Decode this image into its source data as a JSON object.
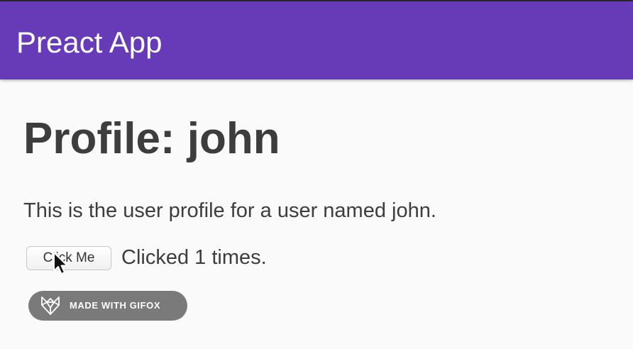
{
  "header": {
    "title": "Preact App",
    "background_color": "#673ab7"
  },
  "profile": {
    "heading": "Profile: john",
    "description": "This is the user profile for a user named john."
  },
  "counter": {
    "button_label": "Click Me",
    "status_text": "Clicked 1 times."
  },
  "badge": {
    "label": "MADE WITH GIFOX",
    "icon": "fox-logo-icon"
  },
  "cursor": {
    "icon": "mouse-pointer-icon"
  }
}
